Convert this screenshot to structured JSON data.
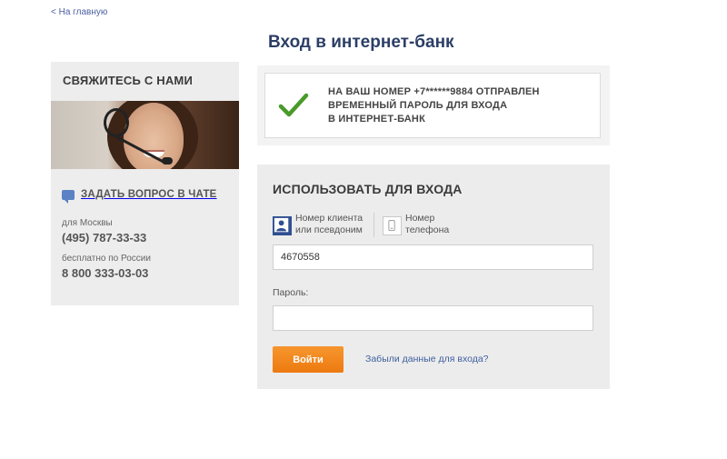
{
  "nav": {
    "back_label": "< На главную"
  },
  "page": {
    "title": "Вход в интернет-банк"
  },
  "contact": {
    "header": "СВЯЖИТЕСЬ С НАМИ",
    "chat_label": "ЗАДАТЬ ВОПРОС В ЧАТЕ",
    "moscow_label": "для Москвы",
    "moscow_phone": "(495) 787-33-33",
    "russia_label": "бесплатно по России",
    "russia_phone": "8 800 333-03-03"
  },
  "notice": {
    "line1": "НА ВАШ НОМЕР +7******9884 ОТПРАВЛЕН",
    "line2": "ВРЕМЕННЫЙ ПАРОЛЬ ДЛЯ ВХОДА",
    "line3": "В ИНТЕРНЕТ-БАНК"
  },
  "login": {
    "title": "ИСПОЛЬЗОВАТЬ ДЛЯ ВХОДА",
    "method_client_line1": "Номер клиента",
    "method_client_line2": "или псевдоним",
    "method_phone_line1": "Номер",
    "method_phone_line2": "телефона",
    "login_value": "4670558",
    "password_label": "Пароль:",
    "password_value": "",
    "submit_label": "Войти",
    "forgot_label": "Забыли данные для входа?"
  },
  "colors": {
    "accent_orange": "#f08520",
    "title_blue": "#2c3e66",
    "check_green": "#4a9a2a"
  }
}
